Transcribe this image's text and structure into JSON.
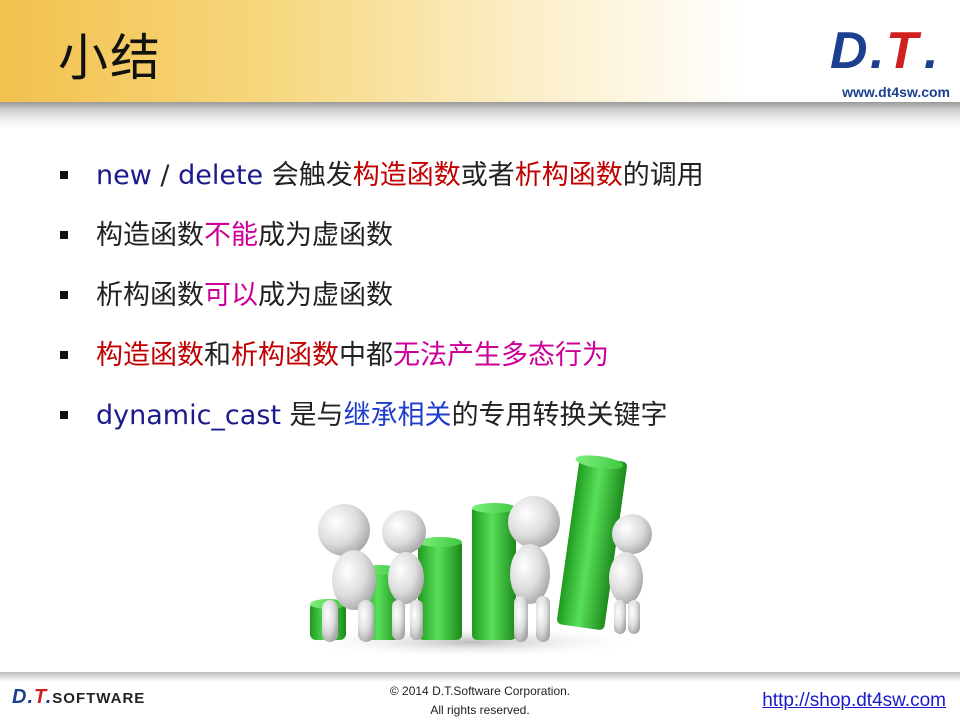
{
  "header": {
    "title": "小结",
    "logo_text_d": "D",
    "logo_text_dot": ".",
    "logo_text_t": "T",
    "logo_text_dot2": ".",
    "logo_url": "www.dt4sw.com"
  },
  "bullets": [
    {
      "parts": [
        {
          "text": "new",
          "style": "en"
        },
        {
          "text": " / ",
          "style": "plain"
        },
        {
          "text": "delete",
          "style": "en"
        },
        {
          "text": " 会触发",
          "style": "plain"
        },
        {
          "text": "构造函数",
          "style": "red"
        },
        {
          "text": "或者",
          "style": "plain"
        },
        {
          "text": "析构函数",
          "style": "red"
        },
        {
          "text": "的调用",
          "style": "plain"
        }
      ]
    },
    {
      "parts": [
        {
          "text": "构造函数",
          "style": "plain"
        },
        {
          "text": "不能",
          "style": "mag"
        },
        {
          "text": "成为虚函数",
          "style": "plain"
        }
      ]
    },
    {
      "parts": [
        {
          "text": "析构函数",
          "style": "plain"
        },
        {
          "text": "可以",
          "style": "mag"
        },
        {
          "text": "成为虚函数",
          "style": "plain"
        }
      ]
    },
    {
      "parts": [
        {
          "text": "构造函数",
          "style": "red"
        },
        {
          "text": "和",
          "style": "plain"
        },
        {
          "text": "析构函数",
          "style": "red"
        },
        {
          "text": "中都",
          "style": "plain"
        },
        {
          "text": "无法产生多态行为",
          "style": "mag"
        }
      ]
    },
    {
      "parts": [
        {
          "text": "dynamic_cast",
          "style": "en"
        },
        {
          "text": " 是与",
          "style": "plain"
        },
        {
          "text": "继承相关",
          "style": "blu"
        },
        {
          "text": "的专用转换关键字",
          "style": "plain"
        }
      ]
    }
  ],
  "footer": {
    "logo_main": "D.",
    "logo_t": "T",
    "logo_dot": ".",
    "logo_software": "SOFTWARE",
    "copyright_line1": "© 2014 D.T.Software Corporation.",
    "copyright_line2": "All rights reserved.",
    "shop_link": "http://shop.dt4sw.com"
  },
  "colors": {
    "header_gold": "#f2c14d",
    "keyword_blue": "#1a1a8c",
    "term_red": "#c00000",
    "emphasis_magenta": "#cc0099",
    "inherit_blue": "#1f3ecc",
    "bar_green": "#3cc23c",
    "logo_blue": "#1c3f8f",
    "logo_red": "#d02020"
  }
}
